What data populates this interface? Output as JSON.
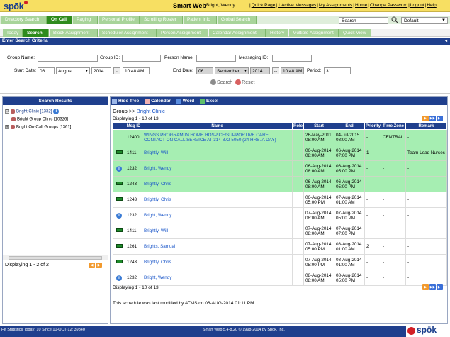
{
  "header": {
    "logo_text": "spōk",
    "app_title": "Smart Web",
    "user": "Bright, Wendy",
    "links": [
      "Quick Page",
      "1 Active Messages",
      "My Assignments",
      "Home",
      "Change Password",
      "Logout",
      "Help"
    ]
  },
  "nav1": {
    "tabs": [
      "Directory Search",
      "On Call",
      "Paging",
      "Personal Profile",
      "Scrolling Roster",
      "Patient Info",
      "Global Search"
    ],
    "active": "On Call",
    "search_value": "Search",
    "select_value": "Default"
  },
  "nav2": {
    "tabs": [
      "Today",
      "Search",
      "Block Assignment",
      "Scheduler Assignment",
      "Person Assignment",
      "Calendar Assignment",
      "History",
      "Multiple Assignment",
      "Quick View"
    ],
    "active": "Search"
  },
  "criteria": {
    "title": "Enter Search Criteria",
    "group_name_label": "Group Name:",
    "group_id_label": "Group ID:",
    "person_name_label": "Person Name:",
    "messaging_id_label": "Messaging ID:",
    "start_date_label": "Start Date:",
    "start_day": "06",
    "start_month": "August",
    "start_year": "2014",
    "start_time": "10:48 AM",
    "end_date_label": "End Date:",
    "end_day": "06",
    "end_month": "September",
    "end_year": "2014",
    "end_time": "10:48 AM",
    "period_label": "Period:",
    "period_value": "31",
    "search_label": "Search",
    "reset_label": "Reset",
    "ellipsis": "..."
  },
  "left": {
    "title": "Search Results",
    "items": [
      {
        "label": "Bright Clinic [1332]",
        "expander": "⊟",
        "link": true,
        "info": "i"
      },
      {
        "label": "Bright Group Clinic [10326]",
        "expander": "",
        "link": false
      },
      {
        "label": "Bright On-Call Groups [1361]",
        "expander": "⊞",
        "link": false
      }
    ],
    "displaying": "Displaying 1 - 2 of 2"
  },
  "right": {
    "toolbar": [
      "Hide Tree",
      "Calendar",
      "Word",
      "Excel"
    ],
    "group_prefix": "Group >> ",
    "group_name": "Bright Clinic",
    "displaying": "Displaying 1 - 10 of 13",
    "columns": [
      "",
      "Msg ID",
      "Name",
      "Role",
      "Start",
      "End",
      "Priority",
      "Time Zone",
      "Remark"
    ],
    "rows": [
      {
        "icon": "",
        "msg_id": "12400",
        "name": "WINGS PROGRAM IN HOME HOSPICE/SUPPORTIVE CARE. CONTACT ON CALL SERVICE AT 314-872-5050 (24 HRS. A DAY)",
        "role": "",
        "start": "26-May-2011 08:00 AM",
        "end": "04-Jul-2015 08:00 AM",
        "priority": "-",
        "tz": "CENTRAL",
        "remark": "-",
        "color": "green"
      },
      {
        "icon": "tel",
        "msg_id": "1411",
        "name": "Brightly, Will",
        "role": "",
        "start": "06-Aug-2014 08:00 AM",
        "end": "06-Aug-2014 07:00 PM",
        "priority": "1",
        "tz": "-",
        "remark": "Team Lead Nurses",
        "color": "green"
      },
      {
        "icon": "info",
        "msg_id": "1232",
        "name": "Bright, Wendy",
        "role": "",
        "start": "06-Aug-2014 08:00 AM",
        "end": "06-Aug-2014 05:00 PM",
        "priority": "-",
        "tz": "-",
        "remark": "-",
        "color": "green"
      },
      {
        "icon": "tel",
        "msg_id": "1243",
        "name": "Brightly, Chris",
        "role": "",
        "start": "06-Aug-2014 08:00 AM",
        "end": "06-Aug-2014 05:00 PM",
        "priority": "-",
        "tz": "-",
        "remark": "-",
        "color": "green"
      },
      {
        "icon": "tel",
        "msg_id": "1243",
        "name": "Brightly, Chris",
        "role": "",
        "start": "06-Aug-2014 05:00 PM",
        "end": "07-Aug-2014 01:00 AM",
        "priority": "-",
        "tz": "-",
        "remark": "-",
        "color": "white"
      },
      {
        "icon": "info",
        "msg_id": "1232",
        "name": "Bright, Wendy",
        "role": "",
        "start": "07-Aug-2014 08:00 AM",
        "end": "07-Aug-2014 05:00 PM",
        "priority": "-",
        "tz": "-",
        "remark": "-",
        "color": "white"
      },
      {
        "icon": "tel",
        "msg_id": "1411",
        "name": "Brightly, Will",
        "role": "",
        "start": "07-Aug-2014 08:00 AM",
        "end": "07-Aug-2014 07:00 PM",
        "priority": "-",
        "tz": "-",
        "remark": "-",
        "color": "white"
      },
      {
        "icon": "tel",
        "msg_id": "1261",
        "name": "Brights, Samual",
        "role": "",
        "start": "07-Aug-2014 05:00 PM",
        "end": "08-Aug-2014 01:00 AM",
        "priority": "2",
        "tz": "-",
        "remark": "-",
        "color": "white"
      },
      {
        "icon": "tel",
        "msg_id": "1243",
        "name": "Brightly, Chris",
        "role": "",
        "start": "07-Aug-2014 05:00 PM",
        "end": "08-Aug-2014 01:00 AM",
        "priority": "-",
        "tz": "-",
        "remark": "-",
        "color": "white"
      },
      {
        "icon": "info",
        "msg_id": "1232",
        "name": "Bright, Wendy",
        "role": "",
        "start": "08-Aug-2014 08:00 AM",
        "end": "08-Aug-2014 05:00 PM",
        "priority": "-",
        "tz": "-",
        "remark": "-",
        "color": "white"
      }
    ],
    "modified": "This schedule was last modified by ATMS on 06-AUG-2014 01:11 PM"
  },
  "footer": {
    "stats": "Hit Statistics Today: 10 Since 10-OCT-12: 39840",
    "copyright": "Smart Web 5.4-8.20 © 1998-2014 by Spōk, Inc.",
    "logo_text": "spōk"
  },
  "colors": {
    "accent": "#1f3f8d",
    "tab_green": "#2e8b1d",
    "row_green": "#a6eeb2",
    "header_yellow": "#f7df62"
  }
}
